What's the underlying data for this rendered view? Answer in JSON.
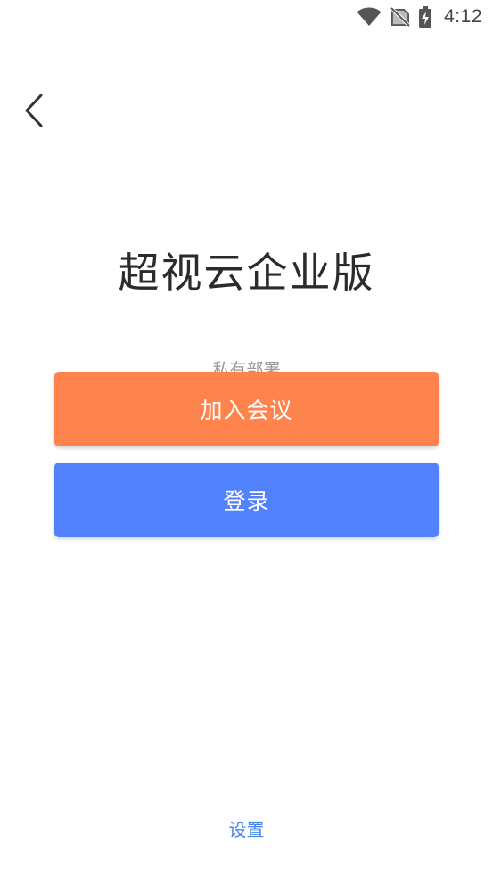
{
  "status_bar": {
    "time": "4:12",
    "icons": [
      "wifi-icon",
      "no-signal-icon",
      "battery-charging-icon"
    ]
  },
  "nav": {
    "back_icon": "chevron-left-icon"
  },
  "main": {
    "title": "超视云企业版",
    "subtitle": "私有部署",
    "join_meeting_label": "加入会议",
    "login_label": "登录"
  },
  "footer": {
    "settings_label": "设置"
  },
  "colors": {
    "join_button": "#ff834d",
    "login_button": "#5282fb",
    "settings_link": "#4a86e8",
    "title_text": "#2b2b2b"
  }
}
